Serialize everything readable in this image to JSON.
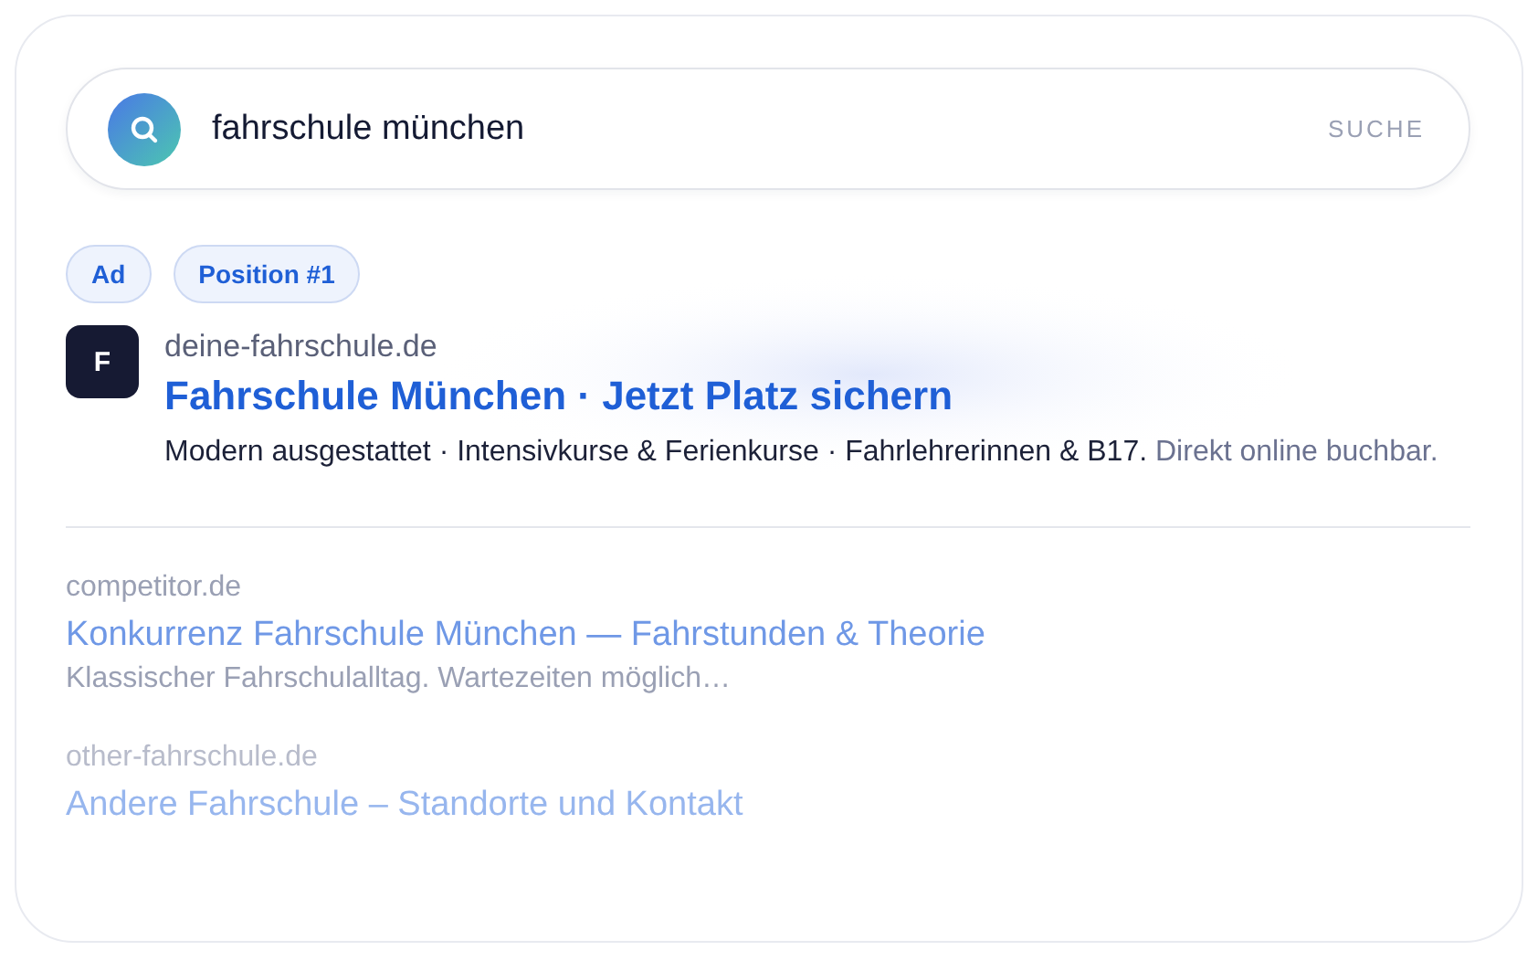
{
  "search": {
    "query": "fahrschule münchen",
    "button": "SUCHE"
  },
  "badges": [
    "Ad",
    "Position #1"
  ],
  "ad": {
    "favicon": "F",
    "domain": "deine-fahrschule.de",
    "title": "Fahrschule München · Jetzt Platz sichern",
    "description": "Modern ausgestattet · Intensivkurse & Ferienkurse · Fahrlehrerinnen & B17.",
    "description_tail": "Direkt online buchbar."
  },
  "results": [
    {
      "domain": "competitor.de",
      "title": "Konkurrenz Fahrschule München — Fahrstunden & Theorie",
      "description": "Klassischer Fahrschulalltag. Wartezeiten möglich…",
      "dimmed": false
    },
    {
      "domain": "other-fahrschule.de",
      "title": "Andere Fahrschule – Standorte und Kontakt",
      "dimmed": true
    }
  ]
}
